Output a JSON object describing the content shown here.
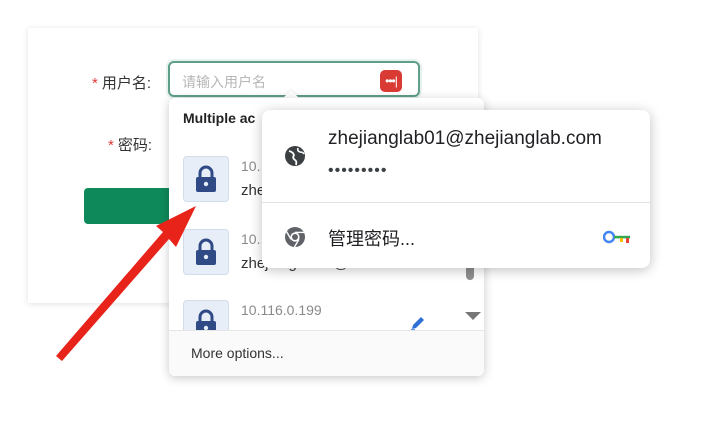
{
  "form": {
    "username_label": "用户名:",
    "password_label": "密码:",
    "required_mark": "*",
    "username_placeholder": "请输入用户名"
  },
  "password_manager_badge": {
    "text": "•••|",
    "color": "#d93a33"
  },
  "autofill": {
    "header": "Multiple ac",
    "accounts": [
      {
        "ip": "10.",
        "user": "zhe"
      },
      {
        "ip": "10.",
        "user": "zhejianglab01@zh..."
      },
      {
        "ip": "10.116.0.199",
        "user": ""
      }
    ],
    "more_options": "More options..."
  },
  "browser_popup": {
    "email": "zhejianglab01@zhejianglab.com",
    "password_mask": "•••••••••",
    "manage_passwords": "管理密码..."
  },
  "colors": {
    "accent_green": "#0e8a5a",
    "annotation_red": "#e8231a",
    "lock_blue": "#2f4a85"
  }
}
